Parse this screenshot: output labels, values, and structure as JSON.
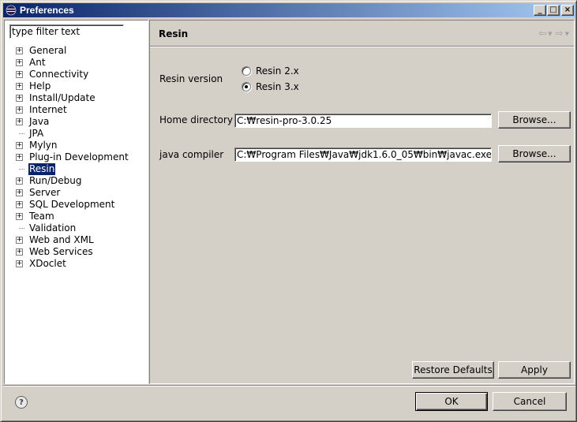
{
  "window": {
    "title": "Preferences",
    "minimize_glyph": "_",
    "maximize_glyph": "□",
    "close_glyph": "×"
  },
  "sidebar": {
    "filter_text": "type filter text",
    "items": [
      {
        "label": "General",
        "expandable": true
      },
      {
        "label": "Ant",
        "expandable": true
      },
      {
        "label": "Connectivity",
        "expandable": true
      },
      {
        "label": "Help",
        "expandable": true
      },
      {
        "label": "Install/Update",
        "expandable": true
      },
      {
        "label": "Internet",
        "expandable": true
      },
      {
        "label": "Java",
        "expandable": true
      },
      {
        "label": "JPA",
        "expandable": false
      },
      {
        "label": "Mylyn",
        "expandable": true
      },
      {
        "label": "Plug-in Development",
        "expandable": true
      },
      {
        "label": "Resin",
        "expandable": false,
        "selected": true
      },
      {
        "label": "Run/Debug",
        "expandable": true
      },
      {
        "label": "Server",
        "expandable": true
      },
      {
        "label": "SQL Development",
        "expandable": true
      },
      {
        "label": "Team",
        "expandable": true
      },
      {
        "label": "Validation",
        "expandable": false
      },
      {
        "label": "Web and XML",
        "expandable": true
      },
      {
        "label": "Web Services",
        "expandable": true
      },
      {
        "label": "XDoclet",
        "expandable": true
      }
    ]
  },
  "page": {
    "title": "Resin",
    "resin_version_label": "Resin version",
    "radio_options": [
      {
        "label": "Resin 2.x",
        "checked": false
      },
      {
        "label": "Resin 3.x",
        "checked": true
      }
    ],
    "home_directory_label": "Home directory",
    "home_directory_value": "C:₩resin-pro-3.0.25",
    "java_compiler_label": "java compiler",
    "java_compiler_value": "C:₩Program Files₩Java₩jdk1.6.0_05₩bin₩javac.exe",
    "browse_label": "Browse...",
    "restore_defaults_label": "Restore Defaults",
    "apply_label": "Apply"
  },
  "footer": {
    "ok_label": "OK",
    "cancel_label": "Cancel",
    "help_glyph": "?"
  },
  "colors": {
    "titlebar_start": "#0a246a",
    "titlebar_end": "#a6caf0",
    "selection": "#0a246a",
    "face": "#d4d0c8"
  }
}
